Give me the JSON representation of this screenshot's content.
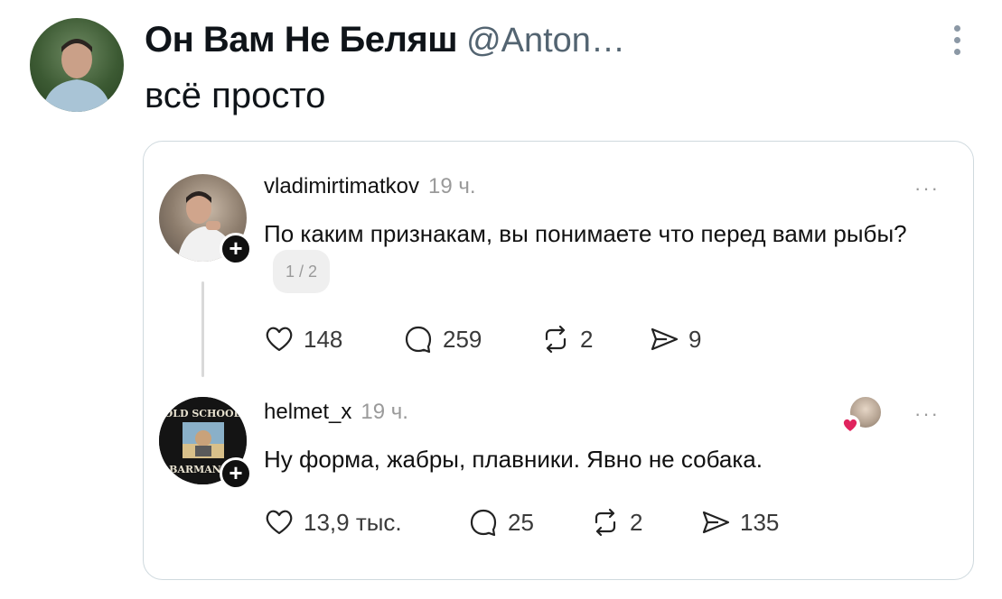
{
  "post": {
    "display_name": "Он Вам Не Беляш",
    "handle": "@Anton…",
    "text": "всё просто"
  },
  "quote": {
    "first": {
      "username": "vladimirtimatkov",
      "time": "19 ч.",
      "text": "По каким признакам, вы понимаете что перед вами рыбы?",
      "page": "1 / 2",
      "likes": "148",
      "replies": "259",
      "reposts": "2",
      "shares": "9"
    },
    "second": {
      "username": "helmet_x",
      "time": "19 ч.",
      "avatar_text_top": "OLD SCHOOL",
      "avatar_text_bottom": "BARMAN",
      "text": "Ну форма, жабры, плавники. Явно не собака.",
      "likes": "13,9 тыс.",
      "replies": "25",
      "reposts": "2",
      "shares": "135"
    },
    "more_label": "···",
    "follow_label": "+"
  },
  "colors": {
    "handle": "#536471",
    "border": "#cfd9de",
    "heart": "#e0245e"
  },
  "icons": [
    "more-vertical-icon",
    "more-horizontal-icon",
    "plus-icon",
    "heart-icon",
    "comment-icon",
    "repost-icon",
    "share-icon"
  ]
}
